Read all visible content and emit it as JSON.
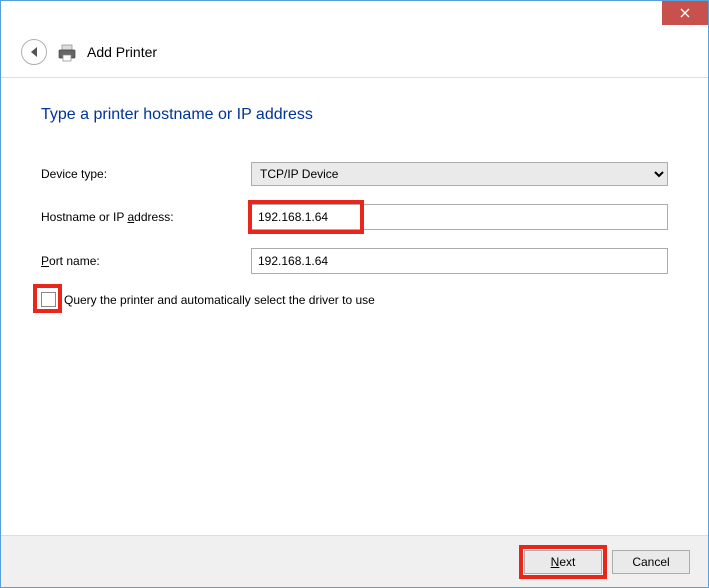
{
  "titlebar": {
    "close_tooltip": "Close"
  },
  "header": {
    "title": "Add Printer"
  },
  "page": {
    "heading": "Type a printer hostname or IP address"
  },
  "form": {
    "device_type_label": "Device type:",
    "device_type_value": "TCP/IP Device",
    "hostname_label_pre": "Hostname or IP ",
    "hostname_label_u": "a",
    "hostname_label_post": "ddress:",
    "hostname_value": "192.168.1.64",
    "port_label_u": "P",
    "port_label_post": "ort name:",
    "port_value": "192.168.1.64",
    "query_label": "Query the printer and automatically select the driver to use"
  },
  "footer": {
    "next_u": "N",
    "next_post": "ext",
    "cancel": "Cancel"
  }
}
